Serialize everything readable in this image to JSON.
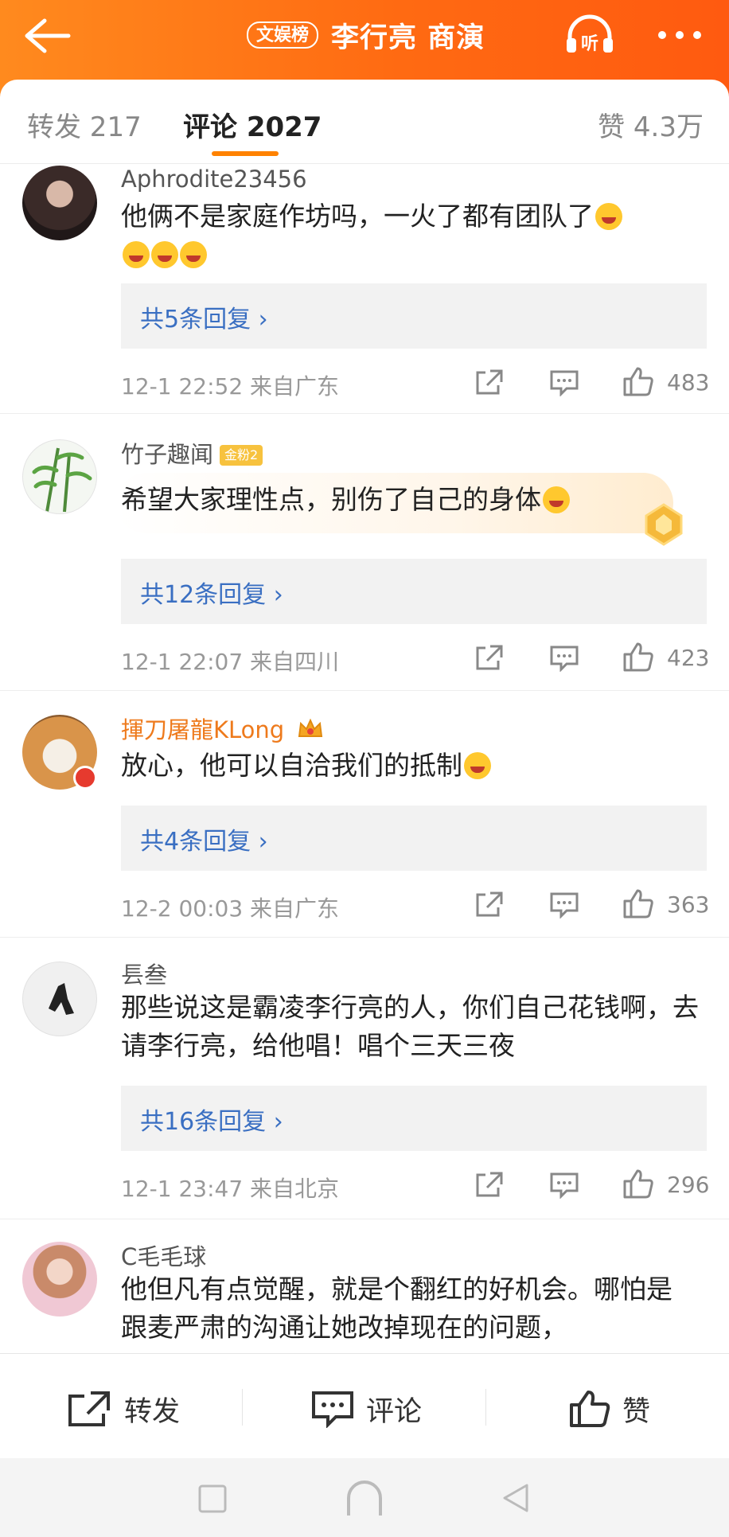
{
  "header": {
    "tag": "文娱榜",
    "title": "李行亮 商演",
    "listen_label": "听"
  },
  "tabs": {
    "forward": "转发 217",
    "comment": "评论 2027",
    "like": "赞 4.3万"
  },
  "comments": [
    {
      "name": "Aphrodite23456",
      "text": "他俩不是家庭作坊吗，一火了都有团队了",
      "replies": "共5条回复 ›",
      "meta": "12-1 22:52 来自广东",
      "likes": "483"
    },
    {
      "name": "竹子趣闻",
      "badge": "金粉2",
      "text": "希望大家理性点，别伤了自己的身体",
      "replies": "共12条回复 ›",
      "meta": "12-1 22:07 来自四川",
      "likes": "423"
    },
    {
      "name": "揮刀屠龍KLong",
      "text": "放心，他可以自洽我们的抵制",
      "replies": "共4条回复 ›",
      "meta": "12-2 00:03 来自广东",
      "likes": "363"
    },
    {
      "name": "镸叁",
      "text": "那些说这是霸凌李行亮的人，你们自己花钱啊，去请李行亮，给他唱！唱个三天三夜",
      "replies": "共16条回复 ›",
      "meta": "12-1 23:47 来自北京",
      "likes": "296"
    },
    {
      "name": "C毛毛球",
      "text": "他但凡有点觉醒，就是个翻红的好机会。哪怕是跟麦严肃的沟通让她改掉现在的问题，"
    }
  ],
  "bottom": {
    "forward": "转发",
    "comment": "评论",
    "like": "赞"
  },
  "colors": {
    "header_orange": "#ff6a12",
    "accent": "#ff8200",
    "link_blue": "#3a6fc2",
    "username_orange": "#ee7a1c",
    "reply_bg": "#f2f2f2"
  }
}
